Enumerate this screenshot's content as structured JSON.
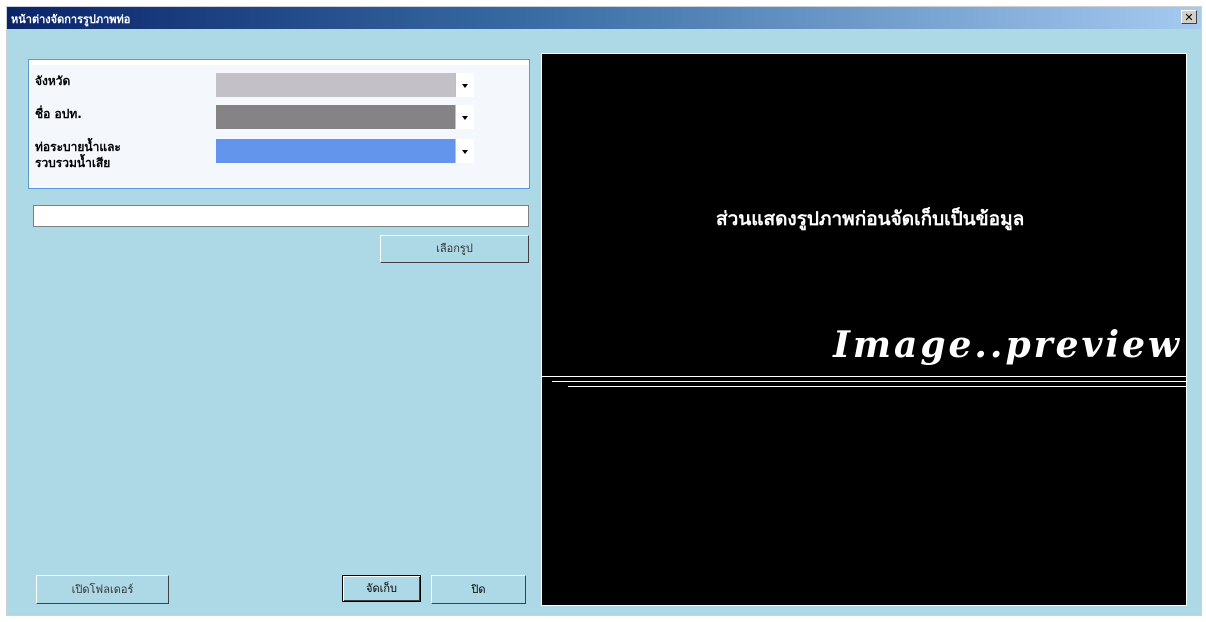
{
  "window": {
    "title": "หน้าต่างจัดการรูปภาพท่อ",
    "close_glyph": "✕"
  },
  "form": {
    "province_label": "จังหวัด",
    "local_admin_label": "ชื่อ อปท.",
    "pipe_label_line1": "ท่อระบายน้ำและ",
    "pipe_label_line2": "รวบรวมน้ำเสีย",
    "province_value": "",
    "local_admin_value": "",
    "pipe_value": "",
    "file_path_value": "",
    "combo_colors": {
      "province": "#c4c0c8",
      "local_admin": "#858385",
      "pipe": "#6495ed"
    }
  },
  "buttons": {
    "select_image": "เลือกรูป",
    "open_folder": "เปิดโฟลเดอร์",
    "save": "จัดเก็บ",
    "close": "ปิด"
  },
  "preview": {
    "caption": "ส่วนแสดงรูปภาพก่อนจัดเก็บเป็นข้อมูล",
    "watermark": "Image..preview"
  }
}
